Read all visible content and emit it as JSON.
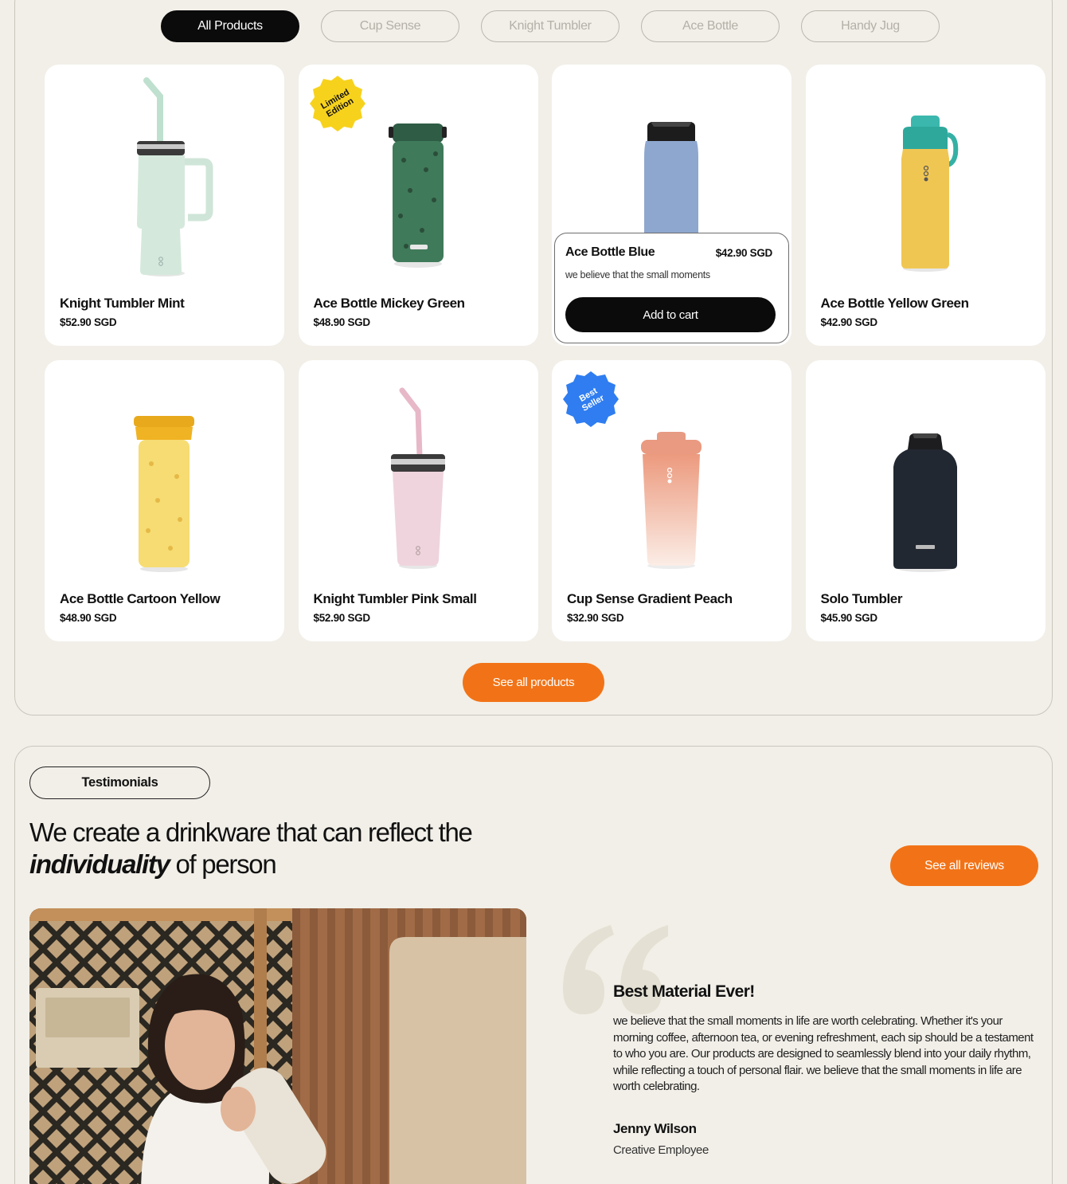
{
  "filters": [
    {
      "label": "All Products",
      "active": true
    },
    {
      "label": "Cup Sense",
      "active": false
    },
    {
      "label": "Knight Tumbler",
      "active": false
    },
    {
      "label": "Ace Bottle",
      "active": false
    },
    {
      "label": "Handy Jug",
      "active": false
    }
  ],
  "products": [
    {
      "name": "Knight Tumbler Mint",
      "price": "$52.90 SGD",
      "image": "mint-tumbler-image"
    },
    {
      "name": "Ace Bottle Mickey Green",
      "price": "$48.90 SGD",
      "image": "green-bottle-image",
      "badge": {
        "line1": "Limited",
        "line2": "Edition",
        "color": "#f7d21d"
      }
    },
    {
      "name": "Ace Bottle Blue",
      "price": "$42.90 SGD",
      "image": "blue-bottle-image",
      "hover": {
        "description": "we believe that the small moments",
        "button": "Add to cart"
      }
    },
    {
      "name": "Ace Bottle Yellow Green",
      "price": "$42.90 SGD",
      "image": "yellow-teal-bottle-image"
    },
    {
      "name": "Ace Bottle Cartoon Yellow",
      "price": "$48.90 SGD",
      "image": "yellow-bottle-image"
    },
    {
      "name": "Knight Tumbler Pink Small",
      "price": "$52.90 SGD",
      "image": "pink-tumbler-image"
    },
    {
      "name": "Cup Sense Gradient Peach",
      "price": "$32.90 SGD",
      "image": "peach-cup-image",
      "badge": {
        "line1": "Best",
        "line2": "Seller",
        "color": "#2f7df0"
      }
    },
    {
      "name": "Solo Tumbler",
      "price": "$45.90 SGD",
      "image": "black-bottle-image"
    }
  ],
  "see_all_products": "See all products",
  "testimonials": {
    "section_label": "Testimonials",
    "headline_line1": "We create a drinkware that can reflect the",
    "headline_em": "individuality",
    "headline_rest": " of person",
    "see_all_reviews": "See all reviews",
    "review": {
      "title": "Best Material Ever!",
      "body": "we believe that the small moments in life are worth celebrating. Whether it's your morning coffee, afternoon tea, or evening refreshment, each sip should be a testament to who you are. Our products are designed to seamlessly blend into your daily rhythm, while reflecting a touch of personal flair. we believe that the small moments in life are worth celebrating.",
      "author": "Jenny Wilson",
      "role": "Creative Employee"
    }
  },
  "colors": {
    "background": "#f2efe8",
    "accent_orange": "#f27317",
    "dark": "#0b0b0b",
    "limited_badge": "#f7d21d",
    "best_seller_badge": "#2f7df0"
  }
}
